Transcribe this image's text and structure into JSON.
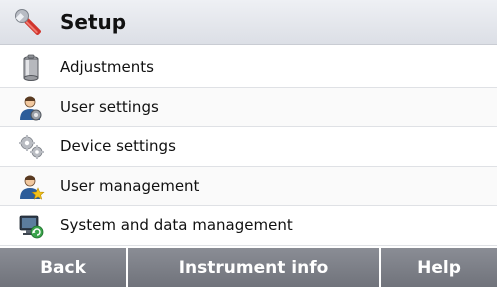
{
  "header": {
    "title": "Setup",
    "icon": "wrench-icon"
  },
  "menu": {
    "items": [
      {
        "label": "Adjustments",
        "icon": "weight-cylinder-icon"
      },
      {
        "label": "User settings",
        "icon": "user-settings-icon"
      },
      {
        "label": "Device settings",
        "icon": "gears-icon"
      },
      {
        "label": "User management",
        "icon": "user-management-icon"
      },
      {
        "label": "System and data management",
        "icon": "system-data-icon"
      }
    ]
  },
  "footer": {
    "back_label": "Back",
    "info_label": "Instrument info",
    "help_label": "Help"
  },
  "colors": {
    "header_bg": "#dcdfe6",
    "footer_bg": "#7d8088",
    "footer_text": "#ffffff"
  }
}
